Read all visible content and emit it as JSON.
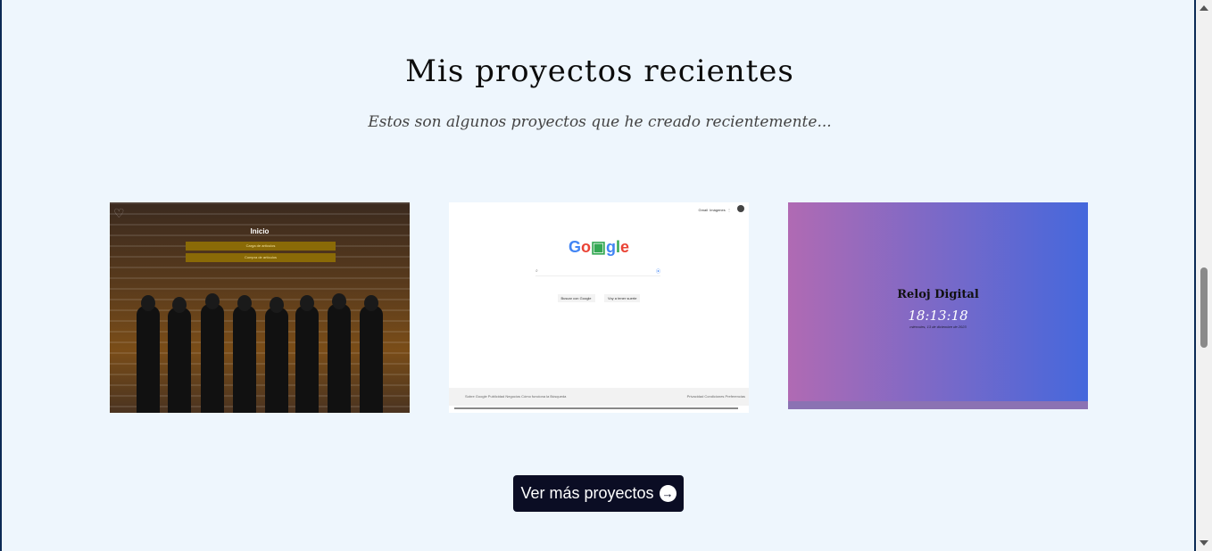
{
  "section": {
    "title": "Mis proyectos recientes",
    "subtitle": "Estos son algunos proyectos que he creado recientemente..."
  },
  "projects": [
    {
      "title": "Inicio",
      "buttons": [
        "Carga de artículos",
        "Compra de artículos"
      ]
    },
    {
      "logo": "Google",
      "top_links": [
        "Gmail",
        "Imágenes"
      ],
      "buttons": [
        "Buscar con Google",
        "Voy a tener suerte"
      ],
      "footer_left": "Sobre Google   Publicidad   Negocios   Cómo funciona la Búsqueda",
      "footer_right": "Privacidad   Condiciones   Preferencias"
    },
    {
      "title": "Reloj Digital",
      "time": "18:13:18",
      "date": "miércoles, 13 de diciembre de 2023"
    }
  ],
  "cta": {
    "label": "Ver más proyectos",
    "icon": "arrow-right-circle-icon"
  }
}
